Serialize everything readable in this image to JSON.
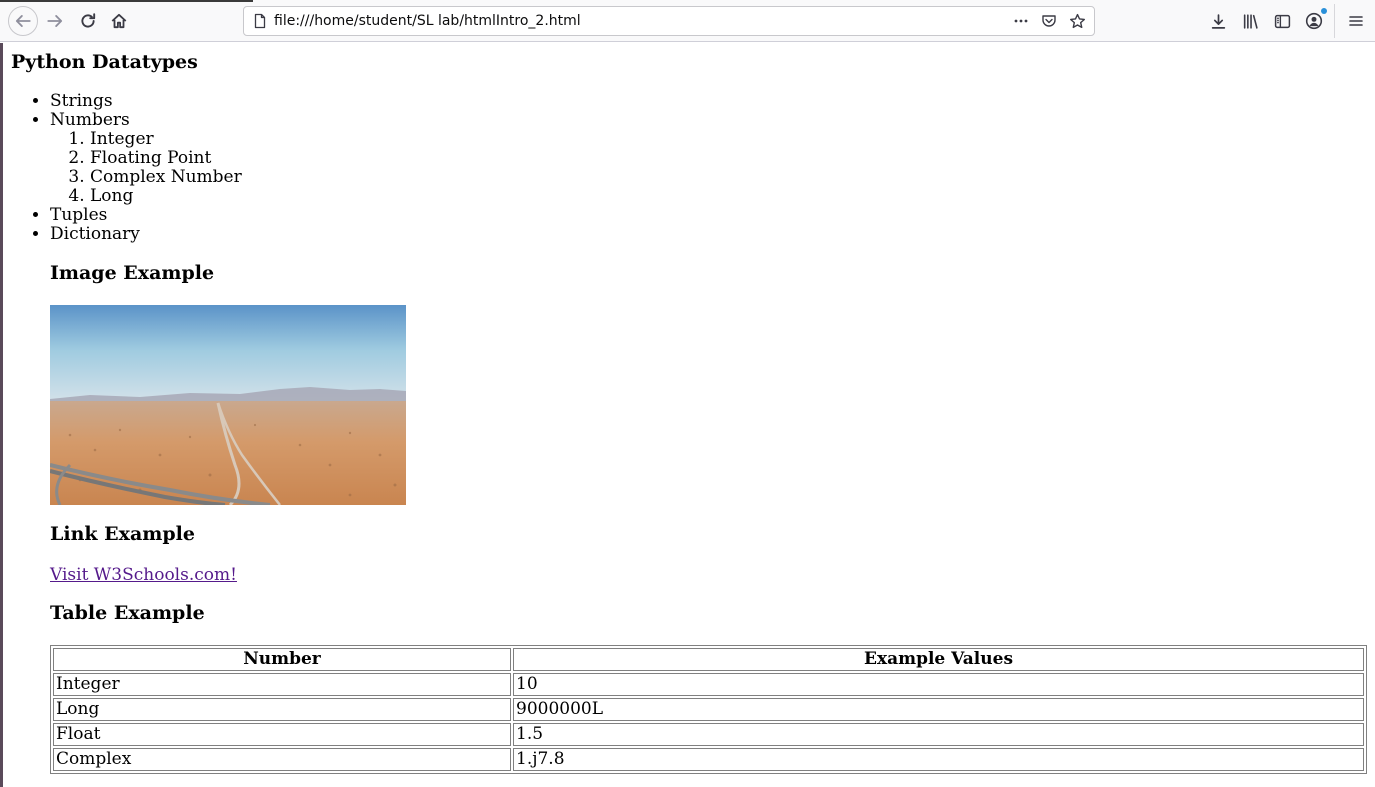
{
  "browser": {
    "url": "file:///home/student/SL lab/htmlIntro_2.html",
    "icons": {
      "back": "arrow-left-icon",
      "forward": "arrow-right-icon",
      "reload": "reload-icon",
      "home": "home-icon",
      "page": "page-icon",
      "more": "more-dots-icon",
      "pocket": "pocket-icon",
      "bookmark": "star-icon",
      "downloads": "download-icon",
      "library": "library-icon",
      "sidebar": "sidebar-icon",
      "account": "account-icon",
      "menu": "hamburger-menu-icon"
    }
  },
  "page": {
    "title": "Python Datatypes",
    "list": {
      "strings": "Strings",
      "numbers": "Numbers",
      "number_types": [
        "Integer",
        "Floating Point",
        "Complex Number",
        "Long"
      ],
      "tuples": "Tuples",
      "dictionary": "Dictionary"
    },
    "image_heading": "Image Example",
    "link_heading": "Link Example",
    "link_text": "Visit W3Schools.com!",
    "table_heading": "Table Example",
    "table": {
      "headers": [
        "Number",
        "Example Values"
      ],
      "rows": [
        [
          "Integer",
          "10"
        ],
        [
          "Long",
          "9000000L"
        ],
        [
          "Float",
          "1.5"
        ],
        [
          "Complex",
          "1.j7.8"
        ]
      ]
    }
  },
  "colors": {
    "visited_link": "#551a8b",
    "toolbar_bg": "#f9f9fa"
  }
}
